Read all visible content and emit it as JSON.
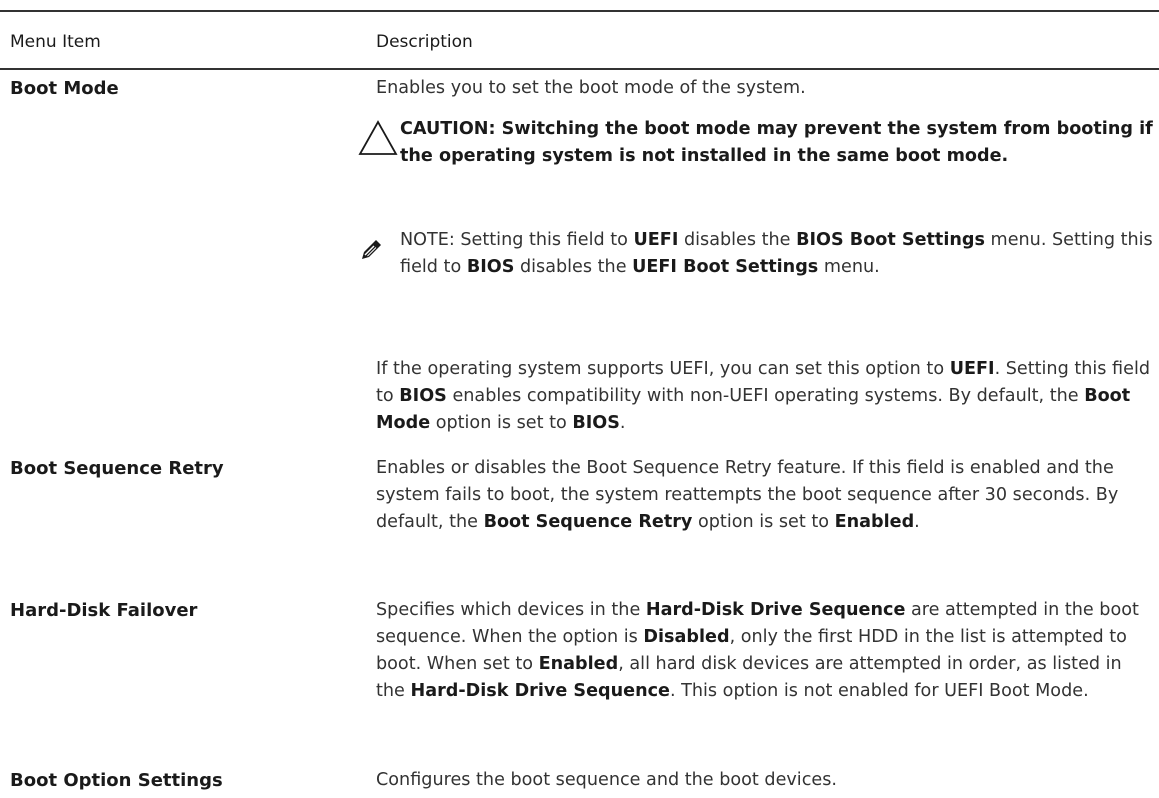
{
  "table": {
    "headers": {
      "menu_item": "Menu Item",
      "description": "Description"
    },
    "rows": [
      {
        "item": "Boot Mode",
        "description": "Enables you to set the boot mode of the system.",
        "caution": "CAUTION: Switching the boot mode may prevent the system from booting if the operating system is not installed in the same boot mode.",
        "note": {
          "prefix": "NOTE: Setting this field to ",
          "term1": "UEFI",
          "mid1": " disables the ",
          "term2": "BIOS Boot Settings",
          "mid2": " menu. Setting this field to ",
          "term3": "BIOS",
          "mid3": " disables the ",
          "term4": "UEFI Boot Settings",
          "suffix": " menu."
        },
        "extra": {
          "t1": "If the operating system supports UEFI, you can set this option to ",
          "b1": "UEFI",
          "t2": ". Setting this field to ",
          "b2": "BIOS",
          "t3": " enables compatibility with non-UEFI operating systems. By default, the ",
          "b3": "Boot Mode",
          "t4": " option is set to ",
          "b4": "BIOS",
          "t5": "."
        }
      },
      {
        "item": "Boot Sequence Retry",
        "description": {
          "t1": "Enables or disables the Boot Sequence Retry feature. If this field is enabled and the system fails to boot, the system reattempts the boot sequence after 30 seconds. By default, the ",
          "b1": "Boot Sequence Retry",
          "t2": " option is set to ",
          "b2": "Enabled",
          "t3": "."
        }
      },
      {
        "item": "Hard-Disk Failover",
        "description": {
          "t1": "Specifies which devices in the ",
          "b1": "Hard-Disk Drive Sequence",
          "t2": " are attempted in the boot sequence. When the option is ",
          "b2": "Disabled",
          "t3": ", only the first HDD in the list is attempted to boot. When set to ",
          "b3": "Enabled",
          "t4": ", all hard disk devices are attempted in order, as listed in the ",
          "b4": "Hard-Disk Drive Sequence",
          "t5": ". This option is not enabled for UEFI Boot Mode."
        }
      },
      {
        "item": "Boot Option Settings",
        "description": "Configures the boot sequence and the boot devices."
      }
    ]
  },
  "icons": {
    "caution": "caution-triangle-icon",
    "note": "pencil-note-icon"
  }
}
